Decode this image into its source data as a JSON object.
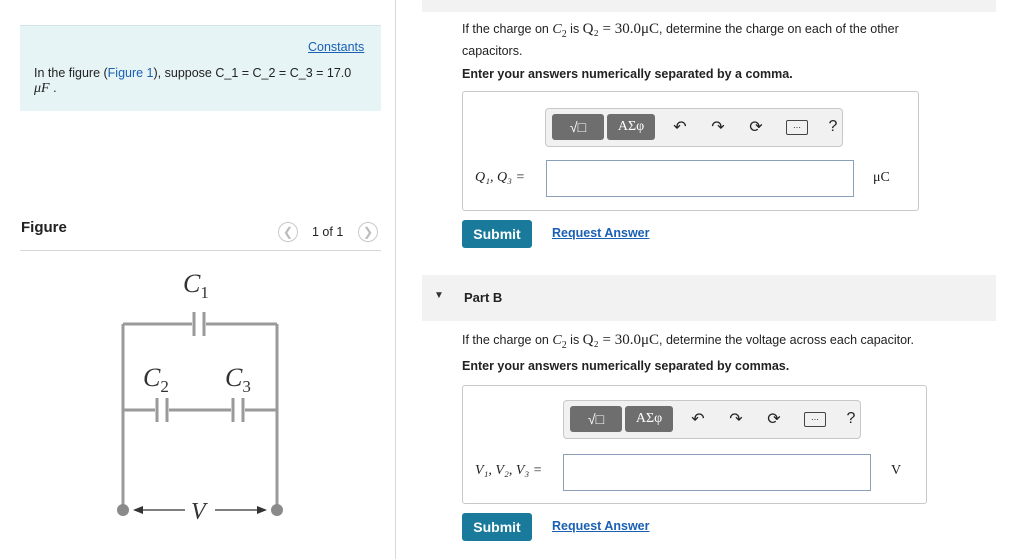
{
  "left": {
    "constants_link": "Constants",
    "problem_text_pre": "In the figure (",
    "figure_link": "Figure 1",
    "problem_text_post": "), suppose C_1 = C_2 = C_3 = 17.0",
    "problem_unit": "μF",
    "problem_unit_end": " .",
    "figure_heading": "Figure",
    "pagination": "1 of 1",
    "circuit": {
      "c1": "C",
      "c1_sub": "1",
      "c2": "C",
      "c2_sub": "2",
      "c3": "C",
      "c3_sub": "3",
      "v": "V"
    }
  },
  "partA": {
    "question_pre": "If the charge on ",
    "q_var": "C",
    "q_sub": "2",
    "question_mid": " is ",
    "charge_expr": "Q₂ = 30.0μC",
    "question_post": ", determine the charge on each of the other capacitors.",
    "instruction": "Enter your answers numerically separated by a comma.",
    "toolbar": {
      "templates_label": "√□",
      "symbols_label": "ΑΣφ",
      "help_label": "?"
    },
    "answer_label": "Q₁, Q₃ =",
    "answer_value": "",
    "unit": "μC",
    "submit_label": "Submit",
    "request_label": "Request Answer"
  },
  "partB": {
    "header": "Part B",
    "question_pre": "If the charge on ",
    "q_var": "C",
    "q_sub": "2",
    "question_mid": " is ",
    "charge_expr": "Q₂ = 30.0μC",
    "question_post": ", determine the voltage across each capacitor.",
    "instruction": "Enter your answers numerically separated by commas.",
    "toolbar": {
      "templates_label": "√□",
      "symbols_label": "ΑΣφ",
      "help_label": "?"
    },
    "answer_label": "V₁, V₂, V₃ =",
    "answer_value": "",
    "unit": "V",
    "submit_label": "Submit",
    "request_label": "Request Answer"
  }
}
